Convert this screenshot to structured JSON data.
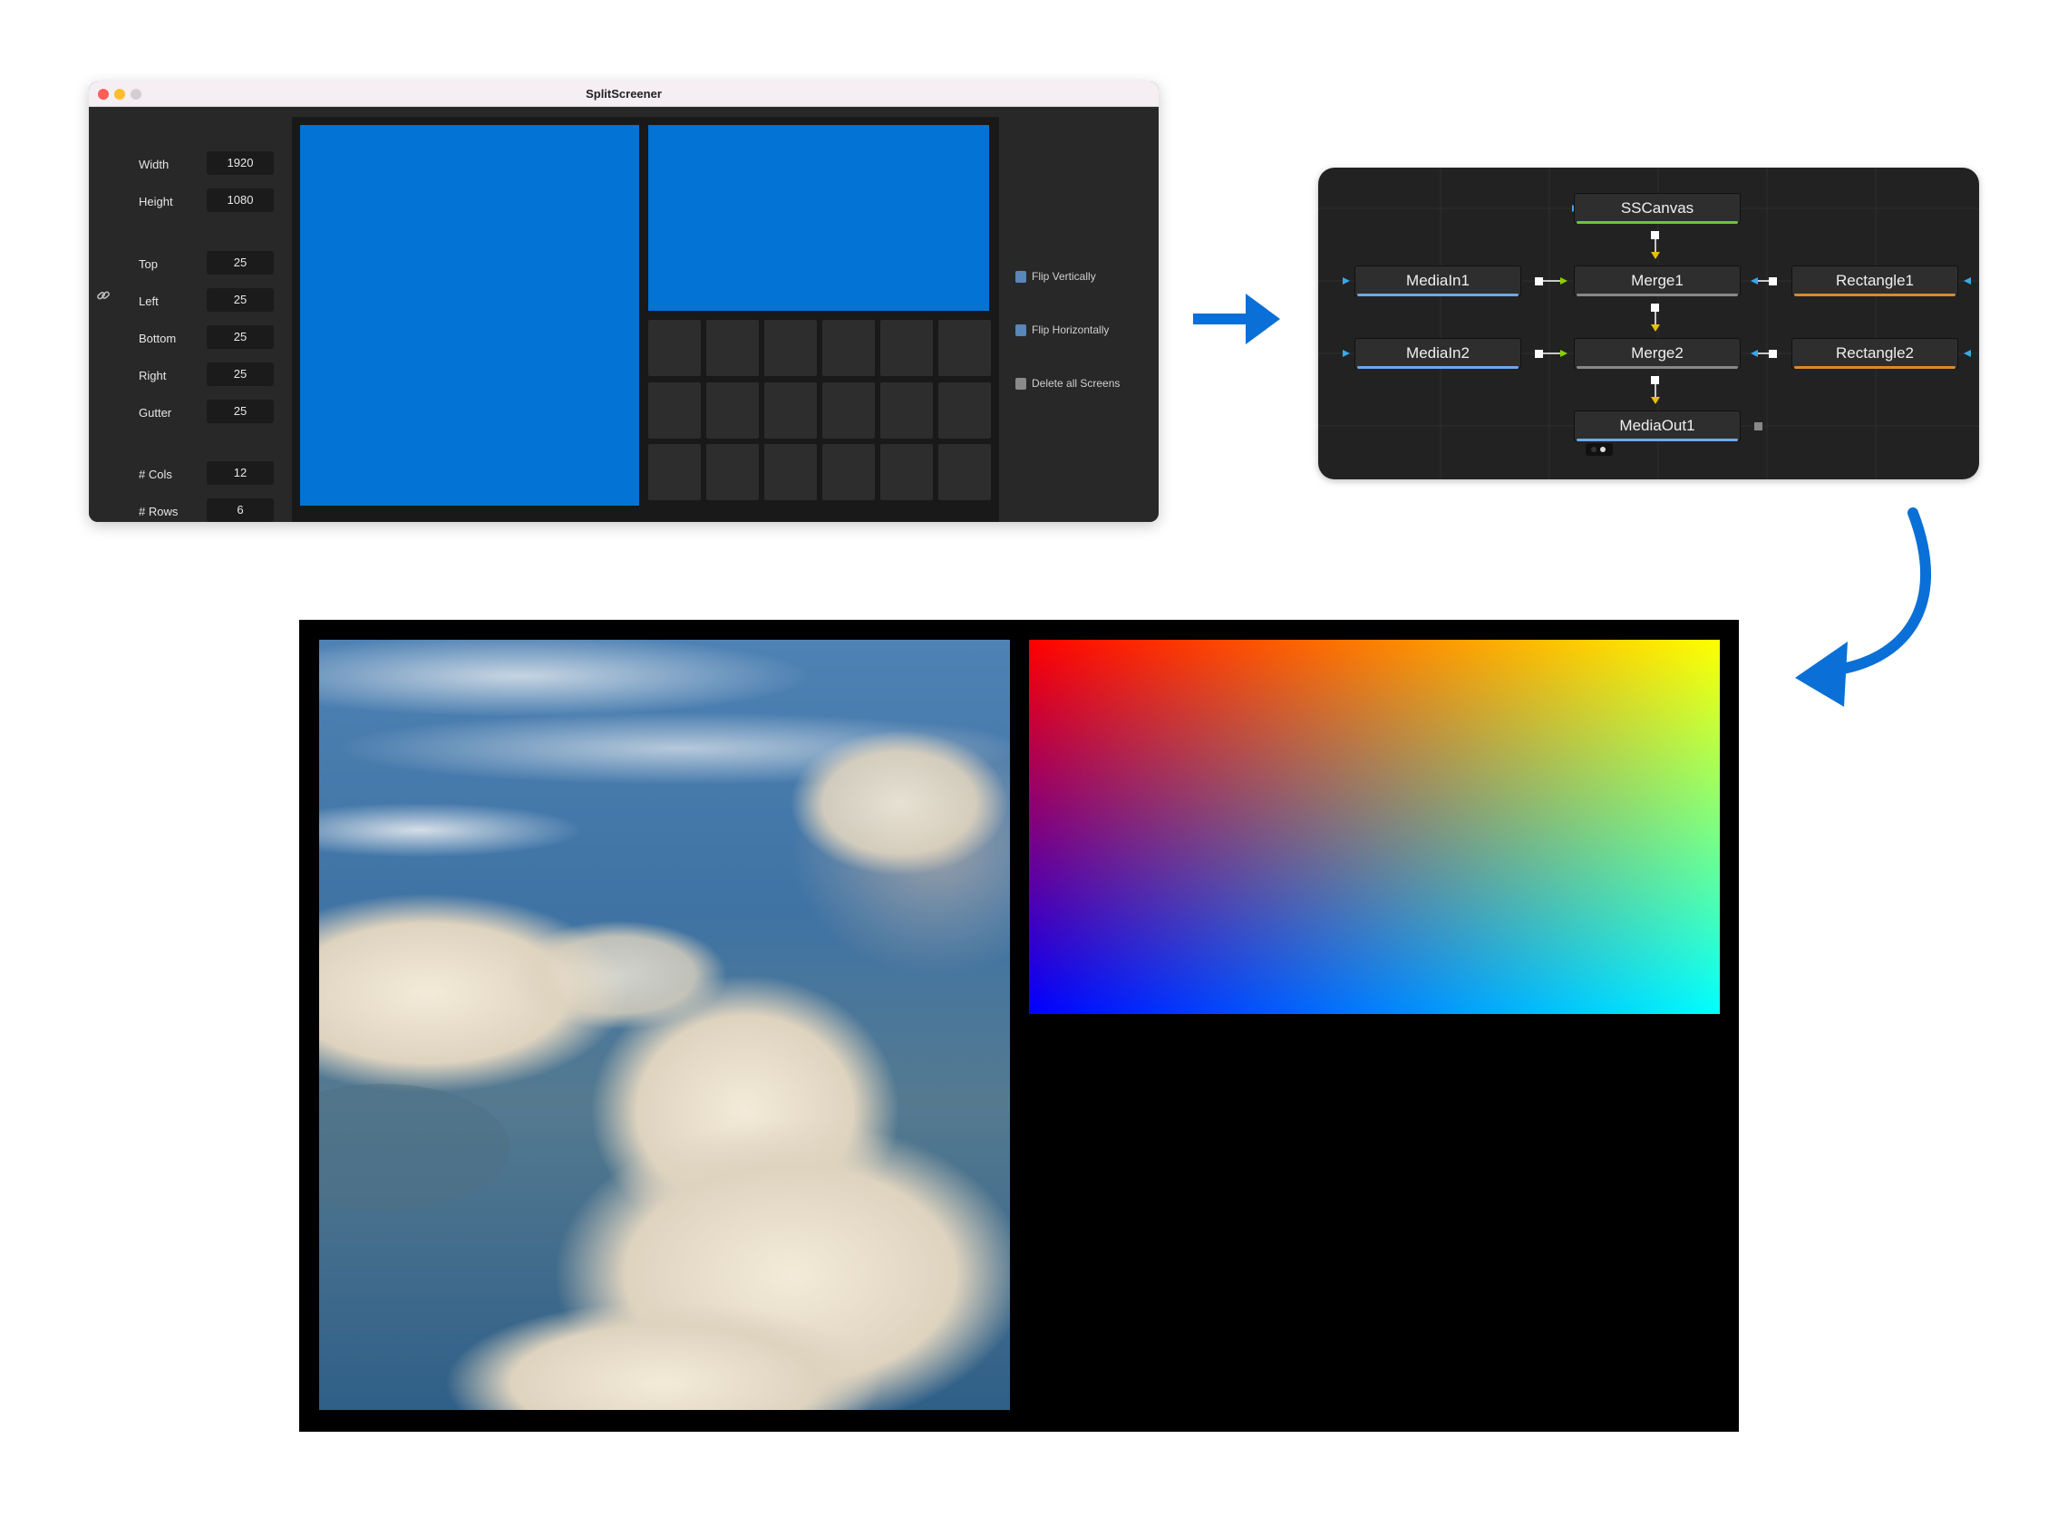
{
  "window": {
    "title": "SplitScreener",
    "fields": [
      {
        "label": "Width",
        "value": "1920"
      },
      {
        "label": "Height",
        "value": "1080"
      },
      {
        "label": "Top",
        "value": "25"
      },
      {
        "label": "Left",
        "value": "25"
      },
      {
        "label": "Bottom",
        "value": "25"
      },
      {
        "label": "Right",
        "value": "25"
      },
      {
        "label": "Gutter",
        "value": "25"
      },
      {
        "label": "# Cols",
        "value": "12"
      },
      {
        "label": "# Rows",
        "value": "6"
      }
    ],
    "actions": [
      {
        "label": "Flip Vertically",
        "icon": "flip-vertical-icon"
      },
      {
        "label": "Flip Horizontally",
        "icon": "flip-horizontal-icon"
      },
      {
        "label": "Delete all Screens",
        "icon": "trash-icon"
      }
    ],
    "colors": {
      "screen": "#0373d6",
      "cell": "#2d2d2d",
      "bg": "#282828"
    }
  },
  "node_graph": {
    "nodes": [
      {
        "name": "SSCanvas",
        "accent": "#6fc33a"
      },
      {
        "name": "MediaIn1",
        "accent": "#6aa9e8"
      },
      {
        "name": "Merge1",
        "accent": "#888888"
      },
      {
        "name": "Rectangle1",
        "accent": "#d98a2b"
      },
      {
        "name": "MediaIn2",
        "accent": "#6aa9e8"
      },
      {
        "name": "Merge2",
        "accent": "#888888"
      },
      {
        "name": "Rectangle2",
        "accent": "#d98a2b"
      },
      {
        "name": "MediaOut1",
        "accent": "#6aa9e8"
      }
    ]
  },
  "arrows": {
    "color": "#0a6fd6"
  }
}
